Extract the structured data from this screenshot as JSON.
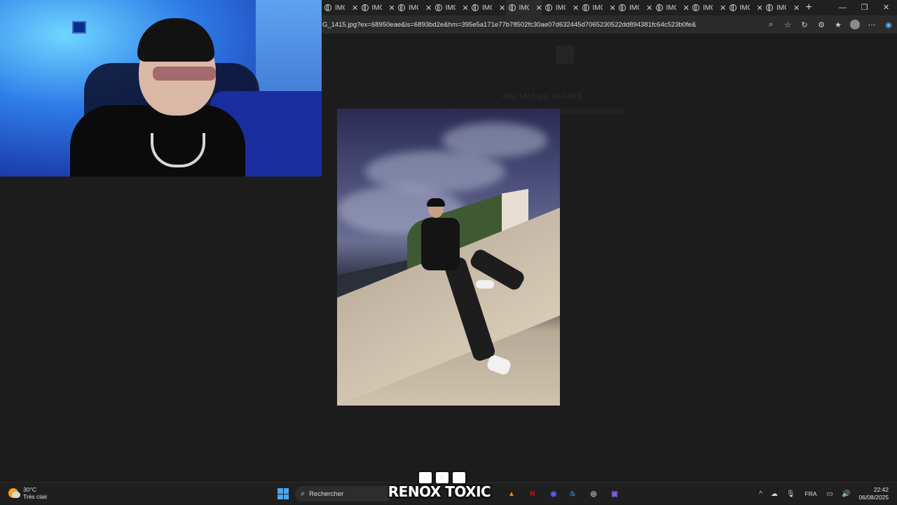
{
  "browser": {
    "tabs": [
      {
        "label": "IMG",
        "active": false
      },
      {
        "label": "IMG",
        "active": false
      },
      {
        "label": "IMG",
        "active": false
      },
      {
        "label": "IMG",
        "active": false
      },
      {
        "label": "IMG",
        "active": false
      },
      {
        "label": "IMG",
        "active": true
      },
      {
        "label": "IMG",
        "active": false
      },
      {
        "label": "IMG",
        "active": false
      },
      {
        "label": "IMG",
        "active": false
      },
      {
        "label": "IMG",
        "active": false
      },
      {
        "label": "IMG",
        "active": false
      },
      {
        "label": "IMG",
        "active": false
      },
      {
        "label": "IMG",
        "active": false
      }
    ],
    "new_tab": "+",
    "url": "G_1415.jpg?ex=68950eae&is=6893bd2e&hm=395e5a171e77b78502fc30ae07d632445d7065230522dd894381fc64c523b0fe&",
    "window_controls": {
      "minimize": "—",
      "restore": "❐",
      "close": "✕"
    }
  },
  "page": {
    "ghost_text": "IMG 1415.jpg, 494.4KB"
  },
  "taskbar": {
    "weather": {
      "temp": "30°C",
      "condition": "Très clair"
    },
    "search_placeholder": "Rechercher",
    "brand": "RENOX TOXIC",
    "brand_badges": [
      "◎",
      "K",
      "♪"
    ],
    "app_icons": [
      {
        "name": "vlc",
        "glyph": "▲",
        "color": "#f08a1c"
      },
      {
        "name": "netflix",
        "glyph": "N",
        "color": "#e50914"
      },
      {
        "name": "discord",
        "glyph": "◉",
        "color": "#5865f2"
      },
      {
        "name": "steam",
        "glyph": "♨",
        "color": "#1b9be0"
      },
      {
        "name": "obs",
        "glyph": "◎",
        "color": "#cfcfcf"
      },
      {
        "name": "app",
        "glyph": "▣",
        "color": "#8a5cf0"
      }
    ],
    "tray": {
      "chevron": "^",
      "lang": "FRA"
    },
    "clock": {
      "time": "22:42",
      "date": "06/08/2025"
    }
  }
}
